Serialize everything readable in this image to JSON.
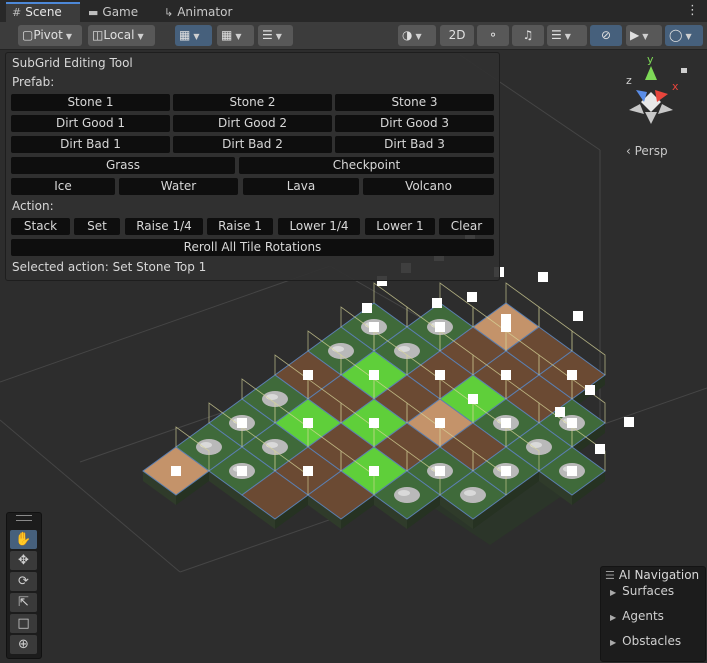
{
  "tabs": [
    {
      "label": "Scene",
      "icon": "grid-icon",
      "active": true
    },
    {
      "label": "Game",
      "icon": "gamepad-icon",
      "active": false
    },
    {
      "label": "Animator",
      "icon": "animator-icon",
      "active": false
    }
  ],
  "toolbar": {
    "pivot_label": "Pivot",
    "local_label": "Local",
    "mode_2d_label": "2D"
  },
  "gizmo": {
    "persp_label": "‹ Persp",
    "axis_x": "x",
    "axis_y": "y",
    "axis_z": "z"
  },
  "panel": {
    "title": "SubGrid Editing Tool",
    "prefab_label": "Prefab:",
    "prefab_rows": [
      [
        "Stone 1",
        "Stone 2",
        "Stone 3"
      ],
      [
        "Dirt Good 1",
        "Dirt Good 2",
        "Dirt Good 3"
      ],
      [
        "Dirt Bad 1",
        "Dirt Bad 2",
        "Dirt Bad 3"
      ],
      [
        "Grass",
        "Checkpoint"
      ],
      [
        "Ice",
        "Water",
        "Lava",
        "Volcano"
      ]
    ],
    "action_label": "Action:",
    "actions": [
      "Stack",
      "Set",
      "Raise 1/4",
      "Raise 1",
      "Lower 1/4",
      "Lower 1",
      "Clear"
    ],
    "reroll_label": "Reroll All Tile Rotations",
    "status": "Selected action: Set Stone Top 1"
  },
  "ai_navigation": {
    "title": "AI Navigation",
    "items": [
      "Surfaces",
      "Agents",
      "Obstacles"
    ]
  },
  "tools": [
    "hand-icon",
    "move-icon",
    "rotate-icon",
    "scale-icon",
    "rect-icon",
    "transform-icon"
  ],
  "colors": {
    "accent": "#46607c",
    "panel_button": "#0e0e0e",
    "grass": "#5fcf3a",
    "dirt": "#6b4a33",
    "sand": "#c4936a",
    "stone_bg": "#3f6a3a",
    "tile_outline": "#d8d69a"
  }
}
